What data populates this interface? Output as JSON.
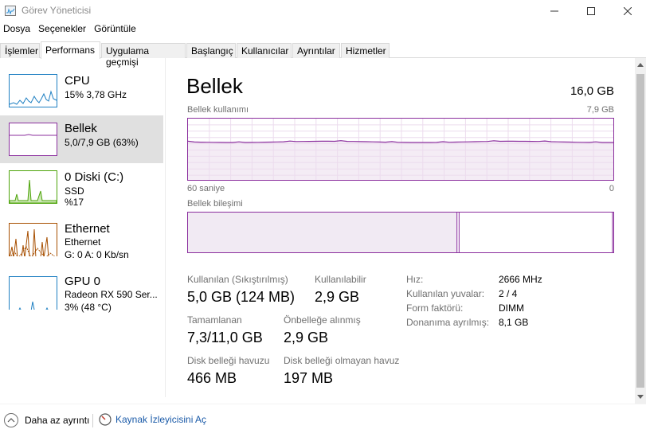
{
  "window": {
    "title": "Görev Yöneticisi",
    "icon": "task-manager-icon"
  },
  "menu": [
    "Dosya",
    "Seçenekler",
    "Görüntüle"
  ],
  "tabs": [
    "İşlemler",
    "Performans",
    "Uygulama geçmişi",
    "Başlangıç",
    "Kullanıcılar",
    "Ayrıntılar",
    "Hizmetler"
  ],
  "active_tab": "Performans",
  "resources": [
    {
      "name": "CPU",
      "line1": "15%  3,78 GHz",
      "line2": "",
      "color": "#1e7fc2",
      "level": 0.15
    },
    {
      "name": "Bellek",
      "line1": "5,0/7,9 GB (63%)",
      "line2": "",
      "color": "#8b2f9e",
      "level": 0.63,
      "selected": true
    },
    {
      "name": "0 Diski (C:)",
      "line1": "SSD",
      "line2": "%17",
      "color": "#4da40a",
      "level": 0.17
    },
    {
      "name": "Ethernet",
      "line1": "Ethernet",
      "line2": "G: 0 A: 0 Kb/sn",
      "color": "#a74f01",
      "level": 0.0
    },
    {
      "name": "GPU 0",
      "line1": "Radeon RX 590 Ser...",
      "line2": "3%  (48 °C)",
      "color": "#1e7fc2",
      "level": 0.03
    }
  ],
  "memory": {
    "title": "Bellek",
    "total": "16,0 GB",
    "usage_label": "Bellek kullanımı",
    "usage_max": "7,9 GB",
    "time_label": "60 saniye",
    "time_end": "0",
    "composition_label": "Bellek bileşimi",
    "usage_fraction": 0.63,
    "in_use_fraction": 0.63,
    "modified_fraction": 0.005,
    "standby_fraction": 0.36,
    "stats": {
      "used_label": "Kullanılan (Sıkıştırılmış)",
      "used_value": "5,0 GB (124 MB)",
      "available_label": "Kullanılabilir",
      "available_value": "2,9 GB",
      "committed_label": "Tamamlanan",
      "committed_value": "7,3/11,0 GB",
      "cached_label": "Önbelleğe alınmış",
      "cached_value": "2,9 GB",
      "paged_label": "Disk belleği havuzu",
      "paged_value": "466 MB",
      "nonpaged_label": "Disk belleği olmayan havuz",
      "nonpaged_value": "197 MB"
    },
    "details": [
      {
        "label": "Hız:",
        "value": "2666 MHz"
      },
      {
        "label": "Kullanılan yuvalar:",
        "value": "2 / 4"
      },
      {
        "label": "Form faktörü:",
        "value": "DIMM"
      },
      {
        "label": "Donanıma ayrılmış:",
        "value": "8,1 GB"
      }
    ]
  },
  "footer": {
    "less_details": "Daha az ayrıntı",
    "resource_monitor": "Kaynak İzleyicisini Aç"
  }
}
